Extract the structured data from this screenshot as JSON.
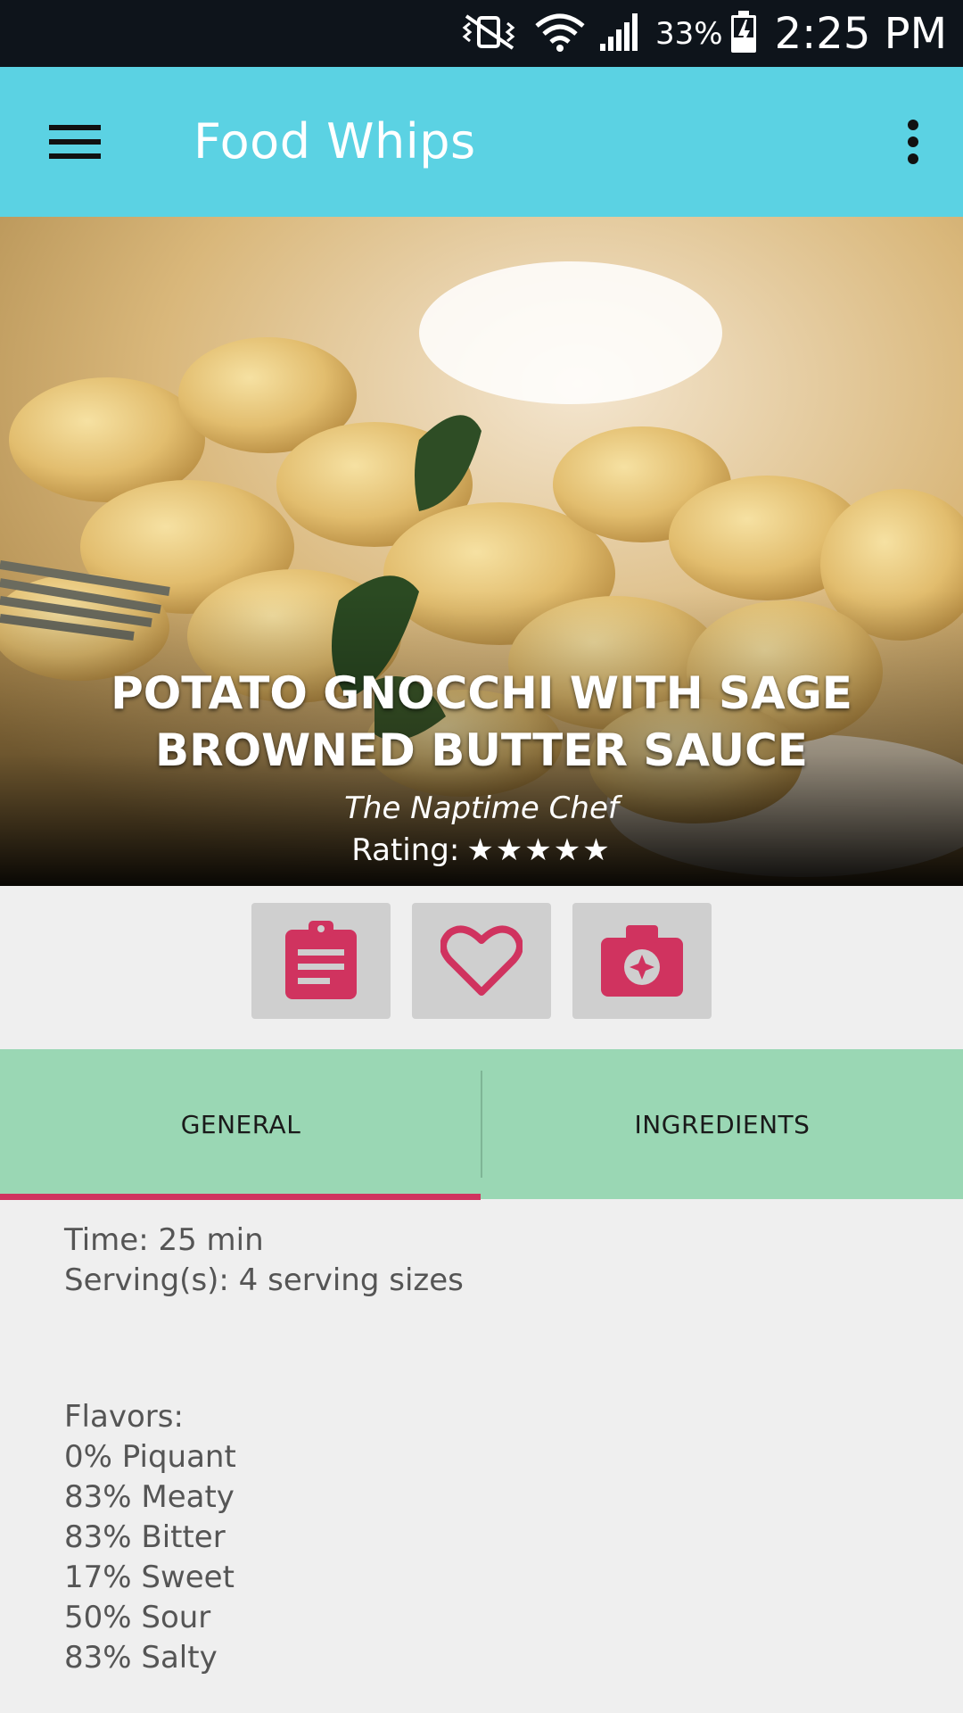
{
  "status_bar": {
    "battery_percent": "33%",
    "time": "2:25 PM"
  },
  "app_bar": {
    "title": "Food Whips"
  },
  "recipe": {
    "title": "POTATO GNOCCHI WITH SAGE BROWNED BUTTER SAUCE",
    "source": "The Naptime Chef",
    "rating_label": "Rating:",
    "rating_stars": "★★★★★",
    "rating_value": 5
  },
  "tabs": [
    {
      "label": "GENERAL",
      "selected": true
    },
    {
      "label": "INGREDIENTS",
      "selected": false
    }
  ],
  "general": {
    "time": "Time: 25 min",
    "servings": "Serving(s): 4 serving sizes",
    "flavors_heading": "Flavors:",
    "flavors": [
      "0% Piquant",
      "83% Meaty",
      "83% Bitter",
      "17% Sweet",
      "50% Sour",
      "83% Salty"
    ]
  },
  "icons": {
    "menu": "hamburger-menu-icon",
    "overflow": "more-vert-icon",
    "notes": "clipboard-icon",
    "favorite": "heart-outline-icon",
    "photo": "camera-icon"
  },
  "colors": {
    "app_bar": "#5bd2e3",
    "tab_bar": "#9ad7b4",
    "accent": "#d0335f",
    "status_bar": "#0e141b"
  }
}
